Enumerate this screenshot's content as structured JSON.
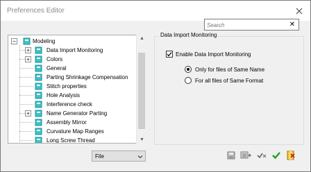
{
  "window": {
    "title": "Preferences Editor"
  },
  "search": {
    "placeholder": "Search",
    "clear": "✕"
  },
  "tree": {
    "items": [
      {
        "label": "Modeling",
        "expander": "−"
      },
      {
        "label": "Data Import Monitoring",
        "expander": "+"
      },
      {
        "label": "Colors",
        "expander": "+"
      },
      {
        "label": "General"
      },
      {
        "label": "Parting Shrinkage Compensation"
      },
      {
        "label": "Stitch properties"
      },
      {
        "label": "Hole Analysis"
      },
      {
        "label": "Interference check"
      },
      {
        "label": "Name Generator Parting",
        "expander": "+"
      },
      {
        "label": "Assembly Mirror"
      },
      {
        "label": "Curvature Map Ranges"
      },
      {
        "label": "Long Screw Thread"
      }
    ]
  },
  "filter": {
    "value": "File"
  },
  "panel": {
    "title": "Data Import Monitoring",
    "enable_label": "Enable Data Import Monitoring",
    "enable_checked": true,
    "radio_same_name": "Only for files of Same Name",
    "radio_same_format": "For all files of Same Format",
    "selected_radio": "same_name"
  },
  "icons": {
    "tree_node": "folder-node-icon",
    "colors": {
      "node_fill": "#3cc3c8",
      "node_dark": "#1f8f95",
      "check_green": "#1ea01e"
    }
  }
}
